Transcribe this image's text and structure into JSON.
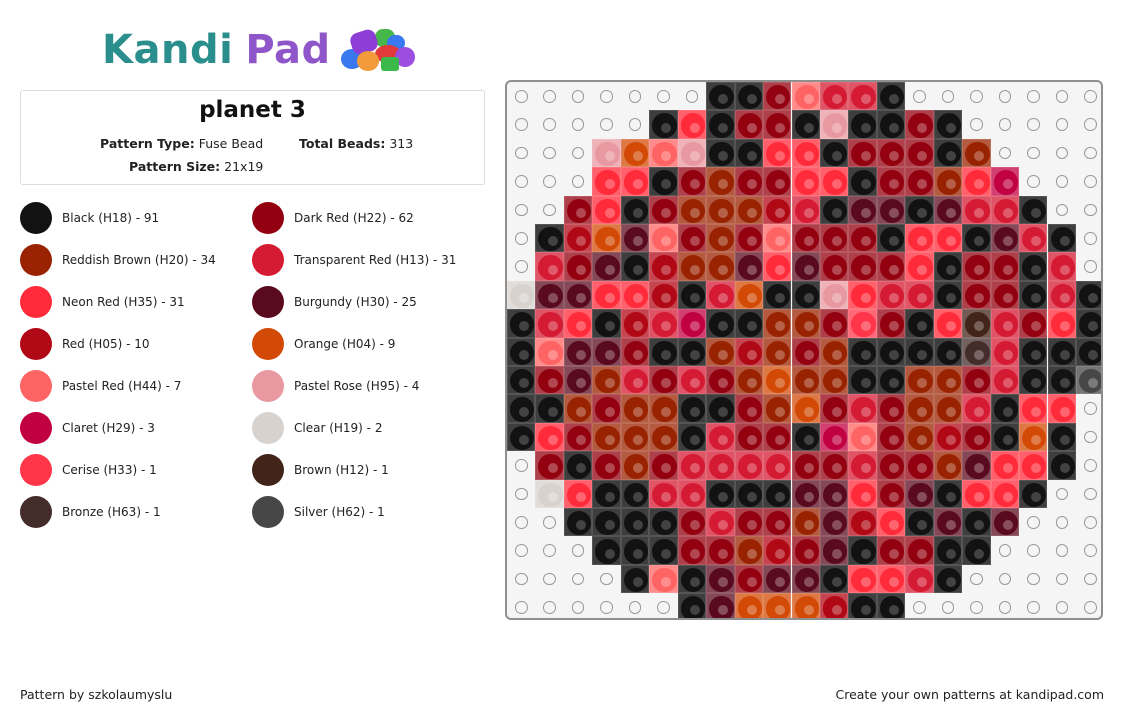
{
  "logo": {
    "part1": "Kandi",
    "part2": "Pad"
  },
  "pattern": {
    "title": "planet 3",
    "type_label": "Pattern Type:",
    "type_value": "Fuse Bead",
    "beads_label": "Total Beads:",
    "beads_value": "313",
    "size_label": "Pattern Size:",
    "size_value": "21x19"
  },
  "palette": {
    "K": {
      "name": "Black (H18) - 91",
      "color": "#121212"
    },
    "DR": {
      "name": "Dark Red (H22) - 62",
      "color": "#93000f"
    },
    "RB": {
      "name": "Reddish Brown (H20) - 34",
      "color": "#992300"
    },
    "TR": {
      "name": "Transparent Red (H13) - 31",
      "color": "#d41b33"
    },
    "NR": {
      "name": "Neon Red (H35) - 31",
      "color": "#ff2a3a"
    },
    "BG": {
      "name": "Burgundy (H30) - 25",
      "color": "#5a0a1e"
    },
    "RD": {
      "name": "Red (H05) - 10",
      "color": "#b10815"
    },
    "OR": {
      "name": "Orange (H04) - 9",
      "color": "#d34a06"
    },
    "PR": {
      "name": "Pastel Red (H44) - 7",
      "color": "#ff6464"
    },
    "PS": {
      "name": "Pastel Rose (H95) - 4",
      "color": "#e898a0"
    },
    "CL": {
      "name": "Claret (H29) - 3",
      "color": "#c10041"
    },
    "CR": {
      "name": "Clear (H19) - 2",
      "color": "#d7d2ce"
    },
    "CE": {
      "name": "Cerise (H33) - 1",
      "color": "#ff3549"
    },
    "BR": {
      "name": "Brown (H12) - 1",
      "color": "#42241a"
    },
    "BZ": {
      "name": "Bronze (H63) - 1",
      "color": "#432c2a"
    },
    "SV": {
      "name": "Silver (H62) - 1",
      "color": "#474747"
    }
  },
  "legend_order": [
    "K",
    "DR",
    "RB",
    "TR",
    "NR",
    "BG",
    "RD",
    "OR",
    "PR",
    "PS",
    "CL",
    "CR",
    "CE",
    "BR",
    "BZ",
    "SV"
  ],
  "grid": {
    "cols": 21,
    "rows": [
      "_ _ _ _ _ _ _ K K DR PR TR TR K _ _ _ _ _ _ _",
      "_ _ _ _ _ K NR K DR DR K PS K K DR K _ _ _ _ _",
      "_ _ _ PS OR PR PS K K NR NR K DR DR DR K RB _ _ _ _",
      "_ _ _ NR NR K DR RB DR DR NR NR K DR DR RB NR CL _ _ _",
      "_ _ DR NR K DR RB RB RB RD TR K BG BG K BG TR TR K _ _",
      "_ K RD OR BG PR DR RB DR PR DR DR DR K NR NR K BG TR K _",
      "_ TR DR BG K RD RB RB BG NR BG DR DR DR NR K DR DR K TR _",
      "CR BG BG NR NR RD K TR OR K K PS NR TR TR K DR DR K TR K",
      "K TR NR K RD TR CL K K RB RB DR CE DR K NR BR TR DR NR K",
      "K PR BG BG DR K K RB RD RB DR RB K K K K BZ TR K K K",
      "K DR BG RB TR DR TR DR RB OR RB RB K K RB RB DR TR K K SV",
      "K K RB DR RB RB K K DR RB OR DR TR DR RB RB TR K NR NR _",
      "K NR DR RB RB RB K TR DR DR K CL PR DR RB RD DR K OR K _",
      "_ DR K DR RB DR TR TR TR TR DR DR TR DR DR RB BG NR NR K _",
      "_ CR NR K K TR TR K K K BG BG NR DR BG K NR NR K _ _",
      "_ _ K K K K DR TR DR DR RB BG RD NR K BG K BG _ _ _",
      "_ _ _ K K K DR DR RB RD DR BG K DR DR K K _ _ _ _",
      "_ _ _ _ K PR K BG DR BG BG K NR NR TR K _ _ _ _ _",
      "_ _ _ _ _ _ K BG OR OR OR RD K K _ _ _ _ _ _ _"
    ]
  },
  "footer": {
    "credit": "Pattern by szkolaumyslu",
    "promo": "Create your own patterns at kandipad.com"
  }
}
